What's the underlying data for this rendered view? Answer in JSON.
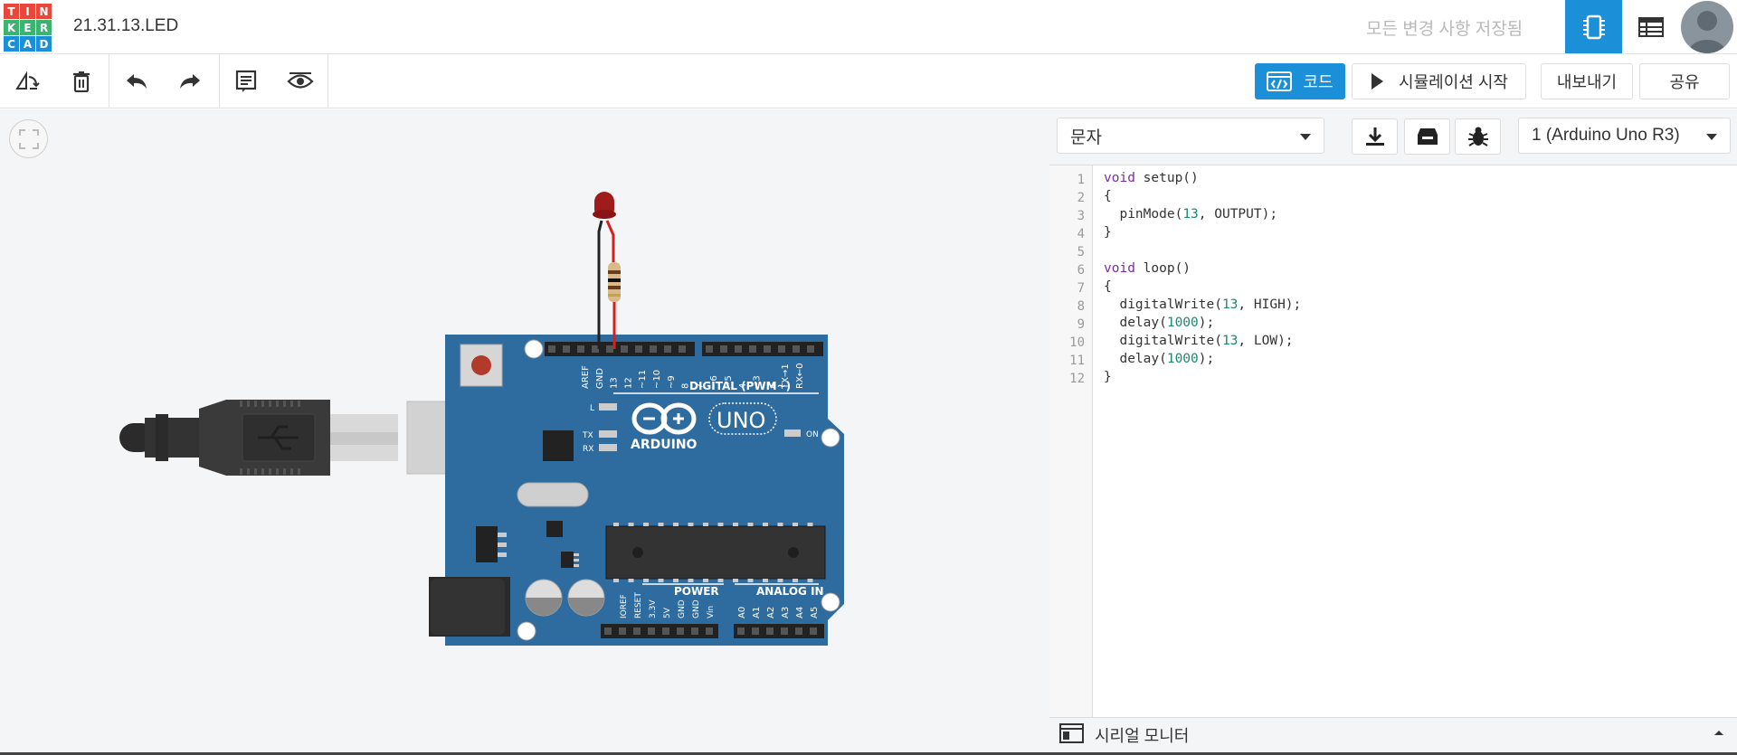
{
  "logo": {
    "letters": [
      "T",
      "I",
      "N",
      "K",
      "E",
      "R",
      "C",
      "A",
      "D"
    ],
    "colors": [
      "#e8483b",
      "#e8483b",
      "#e8483b",
      "#3cb371",
      "#3cb371",
      "#3cb371",
      "#1b8fd8",
      "#1b8fd8",
      "#1b8fd8"
    ]
  },
  "header": {
    "title": "21.31.13.LED",
    "save_status": "모든 변경 사항 저장됨"
  },
  "toolbar": {
    "code_label": "코드",
    "simulate_label": "시뮬레이션 시작",
    "export_label": "내보내기",
    "share_label": "공유"
  },
  "code_panel": {
    "mode_select": "문자",
    "device_select": "1 (Arduino Uno R3)",
    "serial_monitor_label": "시리얼 모니터",
    "line_numbers": [
      "1",
      "2",
      "3",
      "4",
      "5",
      "6",
      "7",
      "8",
      "9",
      "10",
      "11",
      "12"
    ]
  },
  "board": {
    "brand": "ARDUINO",
    "model": "UNO",
    "digital_label": "DIGITAL (PWM~)",
    "power_label": "POWER",
    "analog_label": "ANALOG IN",
    "on_label": "ON",
    "l_label": "L",
    "tx_label": "TX",
    "rx_label": "RX",
    "digital_pins": [
      "AREF",
      "GND",
      "13",
      "12",
      "~11",
      "~10",
      "~9",
      "8",
      "7",
      "~6",
      "~5",
      "4",
      "~3",
      "2",
      "TX→1",
      "RX←0"
    ],
    "power_pins": [
      "IOREF",
      "RESET",
      "3.3V",
      "5V",
      "GND",
      "GND",
      "Vin"
    ],
    "analog_pins": [
      "A0",
      "A1",
      "A2",
      "A3",
      "A4",
      "A5"
    ]
  },
  "colors": {
    "accent": "#1b8fd8",
    "board": "#2e6b9e",
    "keyword": "#7a2d9e",
    "number": "#1a8a6c"
  }
}
